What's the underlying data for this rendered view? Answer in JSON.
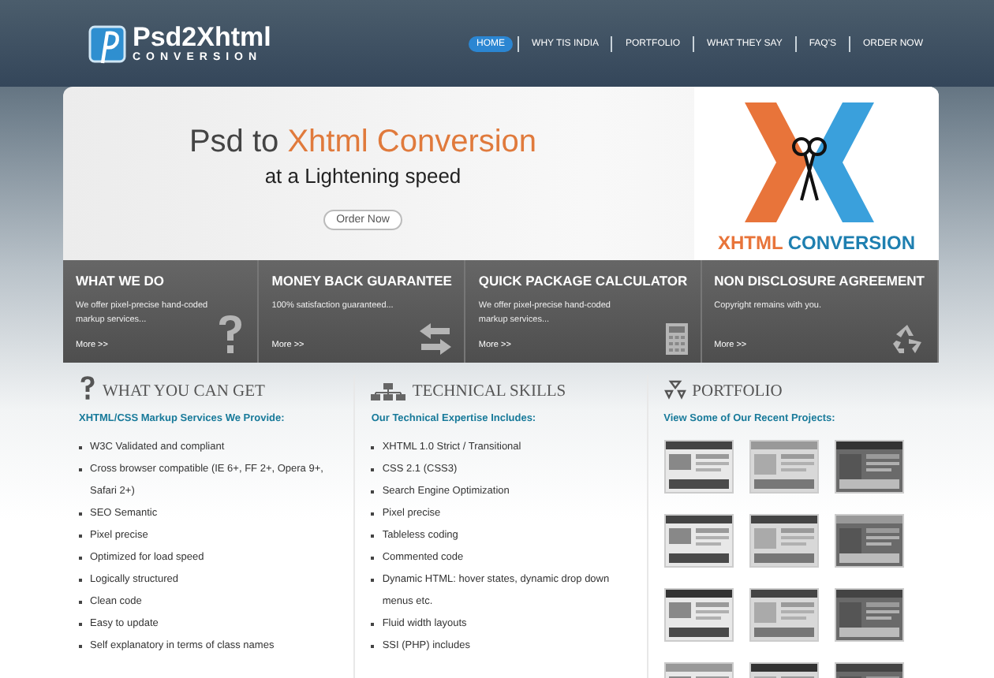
{
  "logo": {
    "name": "Psd2Xhtml",
    "tagline": "CONVERSION"
  },
  "nav": [
    {
      "label": "HOME",
      "selected": true
    },
    {
      "label": "WHY TIS INDIA",
      "selected": false
    },
    {
      "label": "PORTFOLIO",
      "selected": false
    },
    {
      "label": "WHAT THEY SAY",
      "selected": false
    },
    {
      "label": "FAQ'S",
      "selected": false
    },
    {
      "label": "ORDER NOW",
      "selected": false
    }
  ],
  "banner": {
    "headline_lead": "Psd to",
    "headline_accent": "Xhtml Conversion",
    "subline": "at a Lightening speed",
    "button": "Order Now",
    "art_left": "XHTML",
    "art_right": "CONVERSION"
  },
  "features": [
    {
      "title": "WHAT WE DO",
      "text": "We offer pixel-precise hand-coded markup services...",
      "link": "More >>"
    },
    {
      "title": "MONEY BACK GUARANTEE",
      "text": "100% satisfaction guaranteed...",
      "link": "More >>"
    },
    {
      "title": "QUICK PACKAGE CALCULATOR",
      "text": "We offer pixel-precise hand-coded markup services...",
      "link": "More >>"
    },
    {
      "title": "NON DISCLOSURE AGREEMENT",
      "text": "Copyright remains with you.",
      "link": "More >>"
    }
  ],
  "sections": [
    {
      "heading": "WHAT YOU CAN GET",
      "subheading": "XHTML/CSS Markup Services We Provide:",
      "items": [
        "W3C Validated and compliant",
        "Cross browser compatible (IE 6+, FF 2+, Opera 9+, Safari 2+)",
        "SEO Semantic",
        "Pixel precise",
        "Optimized for load speed",
        "Logically structured",
        "Clean code",
        "Easy to update",
        "Self explanatory in terms of class names"
      ]
    },
    {
      "heading": "TECHNICAL SKILLS",
      "subheading": "Our Technical Expertise Includes:",
      "items": [
        "XHTML 1.0 Strict / Transitional",
        "CSS 2.1 (CSS3)",
        "Search Engine Optimization",
        "Pixel precise",
        "Tableless coding",
        "Commented code",
        "Dynamic HTML: hover states, dynamic drop down menus etc.",
        "Fluid width layouts",
        "SSI (PHP) includes"
      ]
    },
    {
      "heading": "PORTFOLIO",
      "subheading": "View Some of Our Recent Projects:"
    }
  ]
}
